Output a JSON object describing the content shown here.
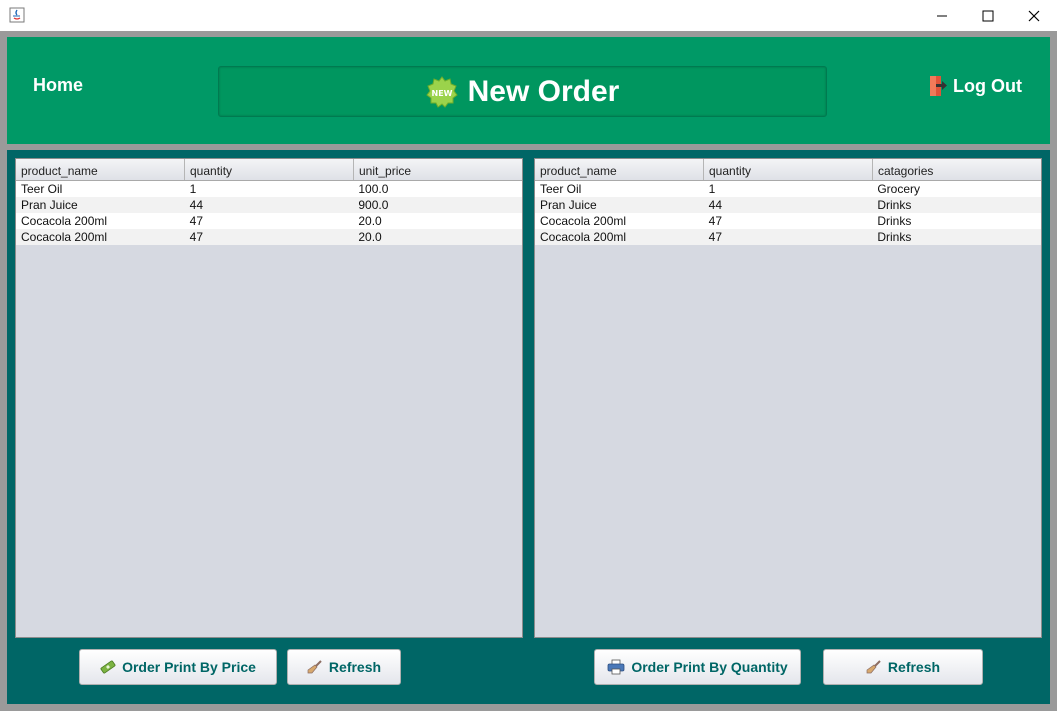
{
  "window": {
    "controls": [
      "minimize",
      "maximize",
      "close"
    ],
    "icon": "java-icon"
  },
  "header": {
    "home_label": "Home",
    "title": "New Order",
    "title_icon": "new-badge-icon",
    "title_icon_text": "NEW",
    "logout_label": "Log Out",
    "logout_icon": "exit-door-icon"
  },
  "colors": {
    "header_bg": "#009966",
    "main_bg": "#006666",
    "table_bg": "#d6d9e1",
    "button_text": "#006666"
  },
  "left_table": {
    "columns": [
      "product_name",
      "quantity",
      "unit_price"
    ],
    "rows": [
      [
        "Teer Oil",
        "1",
        "100.0"
      ],
      [
        "Pran Juice",
        "44",
        "900.0"
      ],
      [
        "Cocacola 200ml",
        "47",
        "20.0"
      ],
      [
        "Cocacola 200ml",
        "47",
        "20.0"
      ]
    ]
  },
  "right_table": {
    "columns": [
      "product_name",
      "quantity",
      "catagories"
    ],
    "rows": [
      [
        "Teer Oil",
        "1",
        "Grocery"
      ],
      [
        "Pran Juice",
        "44",
        "Drinks"
      ],
      [
        "Cocacola 200ml",
        "47",
        "Drinks"
      ],
      [
        "Cocacola 200ml",
        "47",
        "Drinks"
      ]
    ]
  },
  "buttons": {
    "print_by_price": {
      "label": "Order Print By Price",
      "icon": "money-icon"
    },
    "refresh_left": {
      "label": "Refresh",
      "icon": "broom-icon"
    },
    "print_by_quantity": {
      "label": "Order Print By Quantity",
      "icon": "printer-icon"
    },
    "refresh_right": {
      "label": "Refresh",
      "icon": "broom-icon"
    }
  }
}
